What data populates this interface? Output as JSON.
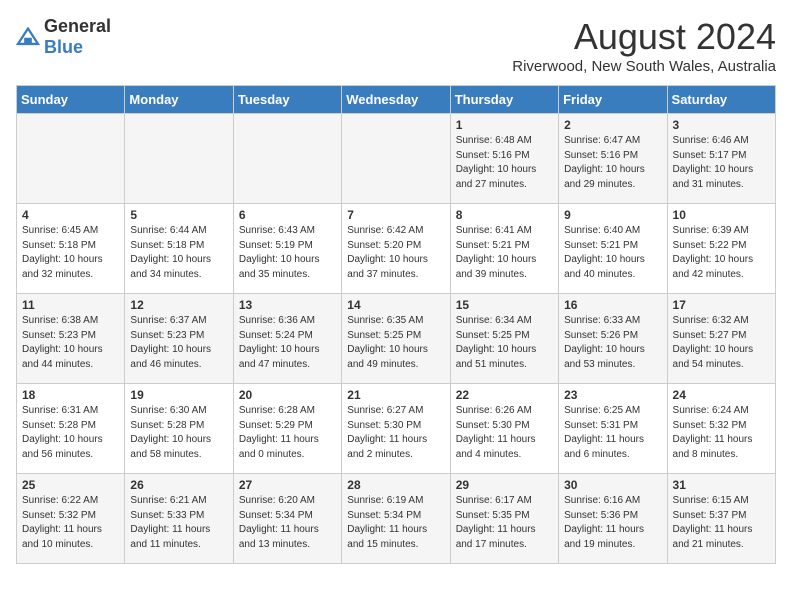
{
  "header": {
    "logo_general": "General",
    "logo_blue": "Blue",
    "month_title": "August 2024",
    "subtitle": "Riverwood, New South Wales, Australia"
  },
  "weekdays": [
    "Sunday",
    "Monday",
    "Tuesday",
    "Wednesday",
    "Thursday",
    "Friday",
    "Saturday"
  ],
  "weeks": [
    [
      {
        "day": "",
        "info": ""
      },
      {
        "day": "",
        "info": ""
      },
      {
        "day": "",
        "info": ""
      },
      {
        "day": "",
        "info": ""
      },
      {
        "day": "1",
        "info": "Sunrise: 6:48 AM\nSunset: 5:16 PM\nDaylight: 10 hours\nand 27 minutes."
      },
      {
        "day": "2",
        "info": "Sunrise: 6:47 AM\nSunset: 5:16 PM\nDaylight: 10 hours\nand 29 minutes."
      },
      {
        "day": "3",
        "info": "Sunrise: 6:46 AM\nSunset: 5:17 PM\nDaylight: 10 hours\nand 31 minutes."
      }
    ],
    [
      {
        "day": "4",
        "info": "Sunrise: 6:45 AM\nSunset: 5:18 PM\nDaylight: 10 hours\nand 32 minutes."
      },
      {
        "day": "5",
        "info": "Sunrise: 6:44 AM\nSunset: 5:18 PM\nDaylight: 10 hours\nand 34 minutes."
      },
      {
        "day": "6",
        "info": "Sunrise: 6:43 AM\nSunset: 5:19 PM\nDaylight: 10 hours\nand 35 minutes."
      },
      {
        "day": "7",
        "info": "Sunrise: 6:42 AM\nSunset: 5:20 PM\nDaylight: 10 hours\nand 37 minutes."
      },
      {
        "day": "8",
        "info": "Sunrise: 6:41 AM\nSunset: 5:21 PM\nDaylight: 10 hours\nand 39 minutes."
      },
      {
        "day": "9",
        "info": "Sunrise: 6:40 AM\nSunset: 5:21 PM\nDaylight: 10 hours\nand 40 minutes."
      },
      {
        "day": "10",
        "info": "Sunrise: 6:39 AM\nSunset: 5:22 PM\nDaylight: 10 hours\nand 42 minutes."
      }
    ],
    [
      {
        "day": "11",
        "info": "Sunrise: 6:38 AM\nSunset: 5:23 PM\nDaylight: 10 hours\nand 44 minutes."
      },
      {
        "day": "12",
        "info": "Sunrise: 6:37 AM\nSunset: 5:23 PM\nDaylight: 10 hours\nand 46 minutes."
      },
      {
        "day": "13",
        "info": "Sunrise: 6:36 AM\nSunset: 5:24 PM\nDaylight: 10 hours\nand 47 minutes."
      },
      {
        "day": "14",
        "info": "Sunrise: 6:35 AM\nSunset: 5:25 PM\nDaylight: 10 hours\nand 49 minutes."
      },
      {
        "day": "15",
        "info": "Sunrise: 6:34 AM\nSunset: 5:25 PM\nDaylight: 10 hours\nand 51 minutes."
      },
      {
        "day": "16",
        "info": "Sunrise: 6:33 AM\nSunset: 5:26 PM\nDaylight: 10 hours\nand 53 minutes."
      },
      {
        "day": "17",
        "info": "Sunrise: 6:32 AM\nSunset: 5:27 PM\nDaylight: 10 hours\nand 54 minutes."
      }
    ],
    [
      {
        "day": "18",
        "info": "Sunrise: 6:31 AM\nSunset: 5:28 PM\nDaylight: 10 hours\nand 56 minutes."
      },
      {
        "day": "19",
        "info": "Sunrise: 6:30 AM\nSunset: 5:28 PM\nDaylight: 10 hours\nand 58 minutes."
      },
      {
        "day": "20",
        "info": "Sunrise: 6:28 AM\nSunset: 5:29 PM\nDaylight: 11 hours\nand 0 minutes."
      },
      {
        "day": "21",
        "info": "Sunrise: 6:27 AM\nSunset: 5:30 PM\nDaylight: 11 hours\nand 2 minutes."
      },
      {
        "day": "22",
        "info": "Sunrise: 6:26 AM\nSunset: 5:30 PM\nDaylight: 11 hours\nand 4 minutes."
      },
      {
        "day": "23",
        "info": "Sunrise: 6:25 AM\nSunset: 5:31 PM\nDaylight: 11 hours\nand 6 minutes."
      },
      {
        "day": "24",
        "info": "Sunrise: 6:24 AM\nSunset: 5:32 PM\nDaylight: 11 hours\nand 8 minutes."
      }
    ],
    [
      {
        "day": "25",
        "info": "Sunrise: 6:22 AM\nSunset: 5:32 PM\nDaylight: 11 hours\nand 10 minutes."
      },
      {
        "day": "26",
        "info": "Sunrise: 6:21 AM\nSunset: 5:33 PM\nDaylight: 11 hours\nand 11 minutes."
      },
      {
        "day": "27",
        "info": "Sunrise: 6:20 AM\nSunset: 5:34 PM\nDaylight: 11 hours\nand 13 minutes."
      },
      {
        "day": "28",
        "info": "Sunrise: 6:19 AM\nSunset: 5:34 PM\nDaylight: 11 hours\nand 15 minutes."
      },
      {
        "day": "29",
        "info": "Sunrise: 6:17 AM\nSunset: 5:35 PM\nDaylight: 11 hours\nand 17 minutes."
      },
      {
        "day": "30",
        "info": "Sunrise: 6:16 AM\nSunset: 5:36 PM\nDaylight: 11 hours\nand 19 minutes."
      },
      {
        "day": "31",
        "info": "Sunrise: 6:15 AM\nSunset: 5:37 PM\nDaylight: 11 hours\nand 21 minutes."
      }
    ]
  ]
}
